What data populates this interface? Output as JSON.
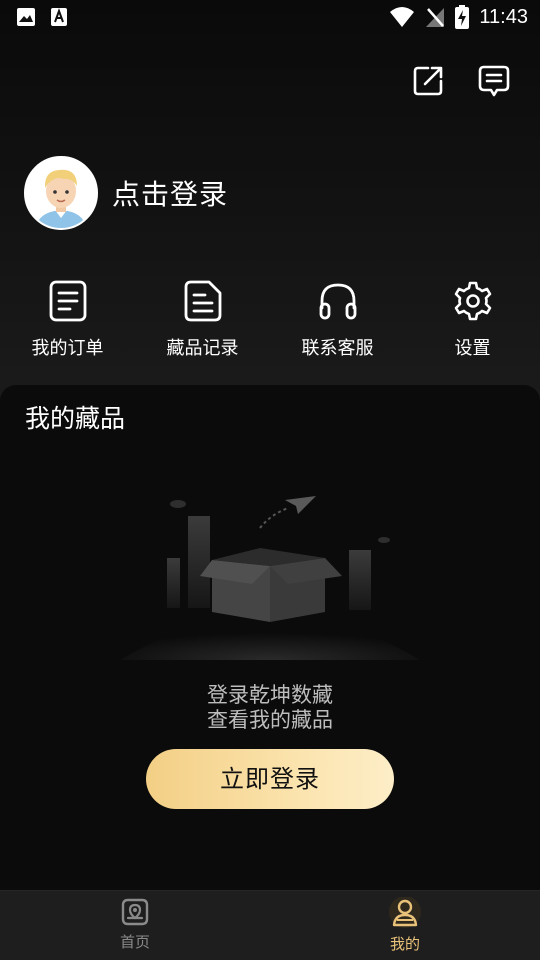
{
  "status_bar": {
    "time": "11:43",
    "left_icons": [
      "image-icon",
      "font-icon"
    ],
    "right_icons": [
      "wifi-icon",
      "no-signal-icon",
      "battery-charging-icon"
    ]
  },
  "top_actions": [
    "share-icon",
    "message-icon"
  ],
  "profile": {
    "login_text": "点击登录"
  },
  "quick_actions": [
    {
      "icon": "order-icon",
      "label": "我的订单"
    },
    {
      "icon": "record-icon",
      "label": "藏品记录"
    },
    {
      "icon": "headphones-icon",
      "label": "联系客服"
    },
    {
      "icon": "gear-icon",
      "label": "设置"
    }
  ],
  "collection": {
    "title": "我的藏品",
    "empty_line1": "登录乾坤数藏",
    "empty_line2": "查看我的藏品",
    "login_button": "立即登录"
  },
  "bottom_nav": [
    {
      "icon": "home-icon",
      "label": "首页",
      "active": false
    },
    {
      "icon": "profile-icon",
      "label": "我的",
      "active": true
    }
  ],
  "colors": {
    "accent_gold": "#e9c27a",
    "button_gradient_start": "#f3cf85",
    "button_gradient_end": "#fdeec8",
    "background": "#0b0b0b"
  }
}
